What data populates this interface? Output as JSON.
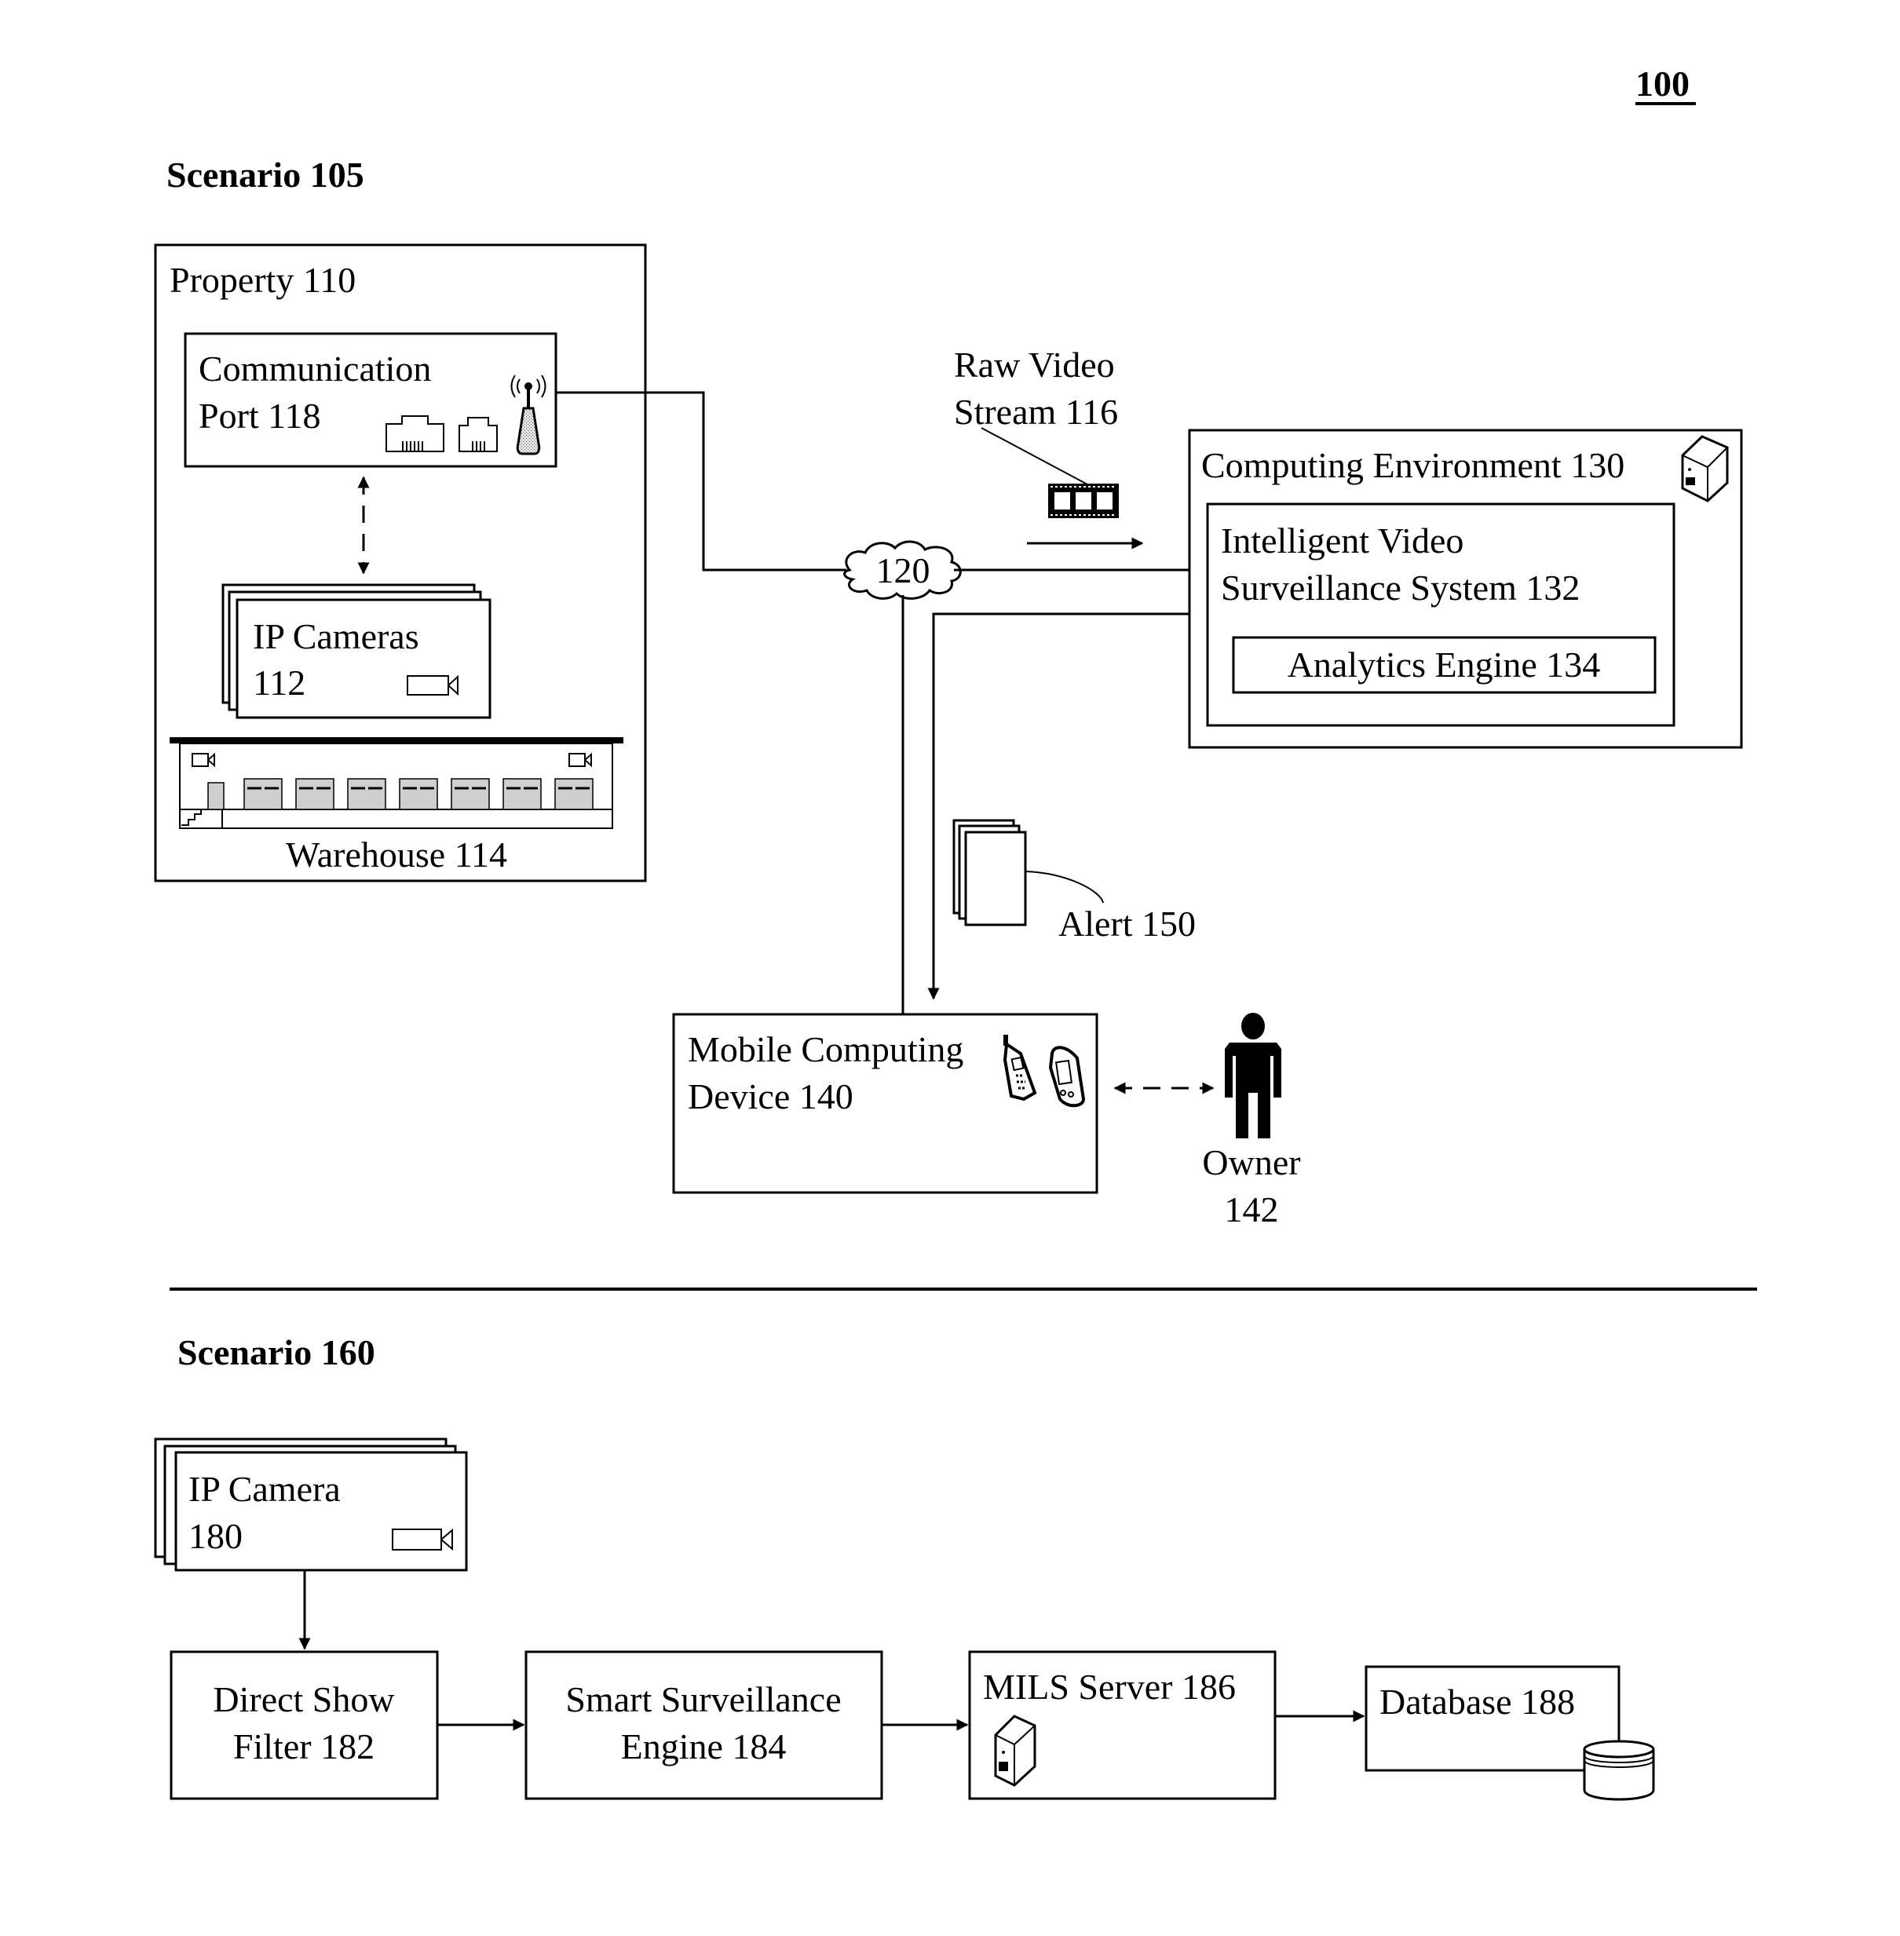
{
  "figure": {
    "number": "100",
    "accent_color": "#000000",
    "background_color": "#ffffff"
  },
  "scenario_105": {
    "title": "Scenario 105",
    "property": {
      "label": "Property 110",
      "communication_port": {
        "line1": "Communication",
        "line2": "Port 118",
        "icons": [
          "ethernet-port-icon",
          "phone-jack-icon",
          "wireless-antenna-icon"
        ]
      },
      "ip_cameras": {
        "line1": "IP Cameras",
        "line2": "112",
        "icon": "video-camera-icon"
      },
      "warehouse": {
        "label": "Warehouse 114",
        "bay_doors": 7,
        "cameras": 2
      }
    },
    "raw_video_stream": {
      "line1": "Raw Video",
      "line2": "Stream 116",
      "icon": "film-strip-icon"
    },
    "network": {
      "label": "120",
      "icon": "cloud-icon"
    },
    "computing_environment": {
      "label": "Computing Environment 130",
      "icon": "server-icon",
      "ivss": {
        "line1": "Intelligent Video",
        "line2": "Surveillance System 132"
      },
      "analytics_engine": {
        "label": "Analytics Engine 134"
      }
    },
    "alert": {
      "label": "Alert 150",
      "icon": "document-stack-icon"
    },
    "mobile_device": {
      "line1": "Mobile Computing",
      "line2": "Device 140",
      "icons": [
        "cell-phone-icon",
        "pda-icon"
      ]
    },
    "owner": {
      "line1": "Owner",
      "line2": "142",
      "icon": "person-icon"
    }
  },
  "scenario_160": {
    "title": "Scenario 160",
    "ip_camera": {
      "line1": "IP Camera",
      "line2": "180",
      "icon": "video-camera-icon"
    },
    "direct_show_filter": {
      "line1": "Direct Show",
      "line2": "Filter 182"
    },
    "smart_surveillance_engine": {
      "line1": "Smart Surveillance",
      "line2": "Engine 184"
    },
    "mils_server": {
      "label": "MILS Server 186",
      "icon": "server-icon"
    },
    "database": {
      "label": "Database 188",
      "icon": "database-cylinder-icon"
    }
  }
}
